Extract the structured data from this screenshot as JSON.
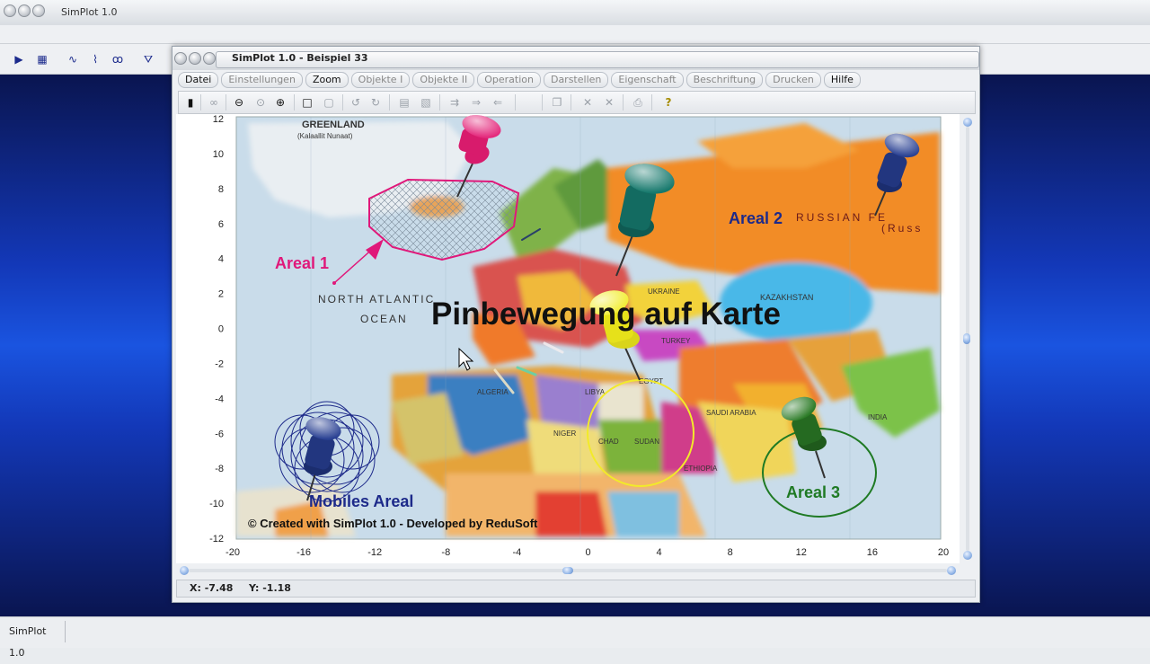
{
  "app": {
    "title": "SimPlot 1.0",
    "taskbar_item": "SimPlot 1.0"
  },
  "window": {
    "title": "SimPlot 1.0 - Beispiel 33"
  },
  "menu": [
    {
      "label": "Datei",
      "active": true
    },
    {
      "label": "Einstellungen",
      "active": false
    },
    {
      "label": "Zoom",
      "active": true
    },
    {
      "label": "Objekte I",
      "active": false
    },
    {
      "label": "Objekte II",
      "active": false
    },
    {
      "label": "Operation",
      "active": false
    },
    {
      "label": "Darstellen",
      "active": false
    },
    {
      "label": "Eigenschaft",
      "active": false
    },
    {
      "label": "Beschriftung",
      "active": false
    },
    {
      "label": "Drucken",
      "active": false
    },
    {
      "label": "Hilfe",
      "active": true
    }
  ],
  "plot": {
    "xlim": [
      -20,
      20
    ],
    "ylim": [
      -12,
      12
    ],
    "x_ticks": [
      "-20",
      "-16",
      "-12",
      "-8",
      "-4",
      "0",
      "4",
      "8",
      "12",
      "16",
      "20"
    ],
    "y_ticks": [
      "12",
      "10",
      "8",
      "6",
      "4",
      "2",
      "0",
      "-2",
      "-4",
      "-6",
      "-8",
      "-10",
      "-12"
    ],
    "title": "Pinbewegung auf Karte",
    "credit": "© Created with SimPlot 1.0 - Developed by ReduSoft",
    "map_labels": {
      "greenland": "GREENLAND",
      "greenland_sub": "(Kalaallit Nunaat)",
      "north_atlantic": "NORTH ATLANTIC",
      "ocean": "OCEAN",
      "russia": "RUSSIAN FE",
      "russia_sub": "(Russ",
      "kazakhstan": "KAZAKHSTAN",
      "egypt": "EGYPT",
      "sudan": "SUDAN",
      "chad": "CHAD",
      "libya": "LIBYA",
      "algeria": "ALGERIA",
      "niger": "NIGER",
      "saudi": "SAUDI ARABIA",
      "ethiopia": "ETHIOPIA",
      "india": "INDIA",
      "ukraine": "UKRAINE",
      "turkey": "TURKEY"
    },
    "areas": [
      {
        "label": "Areal 1",
        "color": "#e0187a"
      },
      {
        "label": "Areal 2",
        "color": "#1d2a8a"
      },
      {
        "label": "Areal 3",
        "color": "#1f7a24"
      },
      {
        "label": "Mobiles Areal",
        "color": "#1d2a8a"
      }
    ],
    "pin_colors": {
      "pink": "#d81b6c",
      "teal": "#0f5a52",
      "navy": "#1b2d6e",
      "yellow": "#e6e11a",
      "green": "#1f5a1c"
    }
  },
  "status": {
    "x": "X: -7.48",
    "y": "Y: -1.18"
  }
}
